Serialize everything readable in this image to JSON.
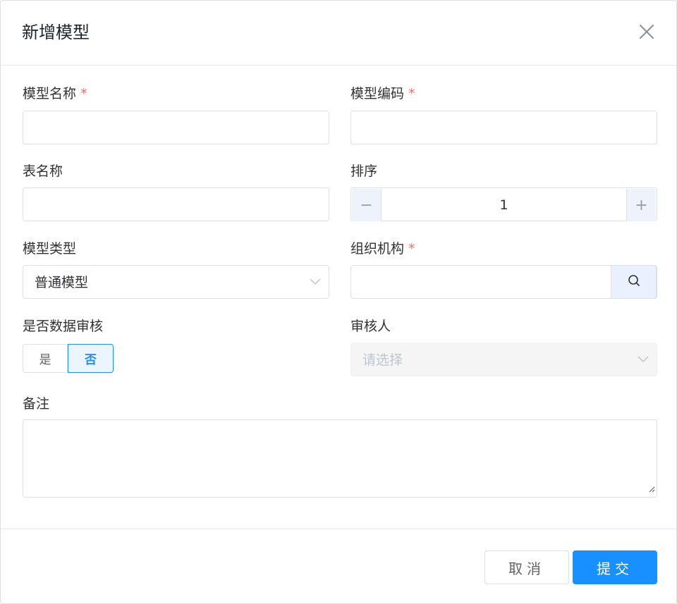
{
  "dialog": {
    "title": "新增模型",
    "close_icon": "close-icon"
  },
  "form": {
    "model_name": {
      "label": "模型名称",
      "required_mark": "*",
      "value": ""
    },
    "model_code": {
      "label": "模型编码",
      "required_mark": "*",
      "value": ""
    },
    "table_name": {
      "label": "表名称",
      "value": ""
    },
    "sort": {
      "label": "排序",
      "value": "1",
      "minus": "−",
      "plus": "+"
    },
    "model_type": {
      "label": "模型类型",
      "value": "普通模型",
      "icon": "chevron-down-icon"
    },
    "org": {
      "label": "组织机构",
      "required_mark": "*",
      "value": "",
      "icon": "search-icon"
    },
    "audit": {
      "label": "是否数据审核",
      "options": [
        "是",
        "否"
      ],
      "selected": "否"
    },
    "reviewer": {
      "label": "审核人",
      "placeholder": "请选择",
      "disabled": true,
      "icon": "chevron-down-icon"
    },
    "remark": {
      "label": "备注",
      "value": ""
    }
  },
  "footer": {
    "cancel_label": "取消",
    "submit_label": "提交"
  },
  "colors": {
    "primary": "#1890ff",
    "required": "#f56c6c",
    "border": "#dcdfe6"
  }
}
